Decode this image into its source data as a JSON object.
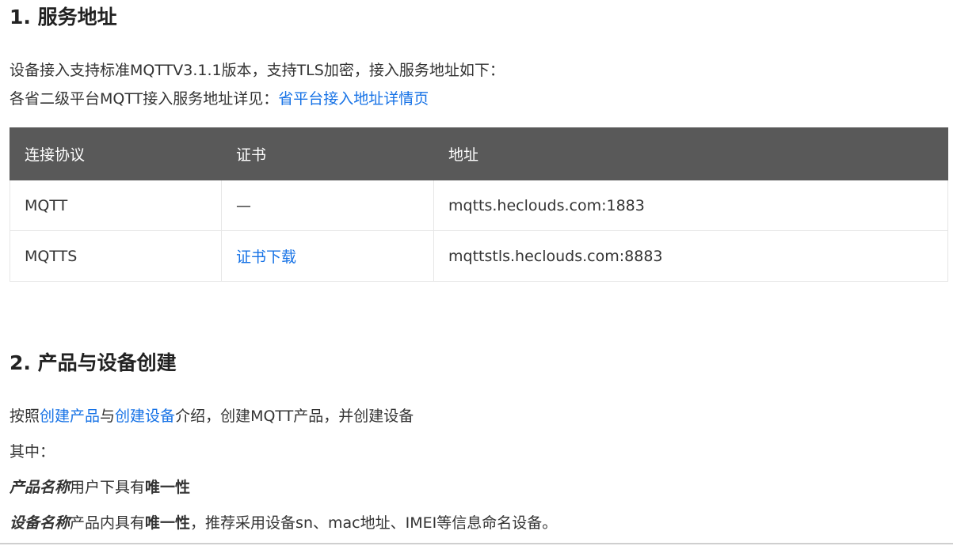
{
  "section1": {
    "heading": "1. 服务地址",
    "line1": "设备接入支持标准MQTTV3.1.1版本，支持TLS加密，接入服务地址如下：",
    "line2_prefix": "各省二级平台MQTT接入服务地址详见：",
    "line2_link": "省平台接入地址详情页",
    "table": {
      "headers": [
        "连接协议",
        "证书",
        "地址"
      ],
      "rows": [
        {
          "protocol": "MQTT",
          "cert": "—",
          "address": "mqtts.heclouds.com:1883"
        },
        {
          "protocol": "MQTTS",
          "cert": "证书下载",
          "address": "mqttstls.heclouds.com:8883"
        }
      ]
    }
  },
  "section2": {
    "heading": "2. 产品与设备创建",
    "line1_prefix": "按照",
    "line1_link1": "创建产品",
    "line1_mid": "与",
    "line1_link2": "创建设备",
    "line1_suffix": "介绍，创建MQTT产品，并创建设备",
    "line2": "其中：",
    "line3_em": "产品名称",
    "line3_mid": "用户下具有",
    "line3_bold": "唯一性",
    "line4_em": "设备名称",
    "line4_mid": "产品内具有",
    "line4_bold": "唯一性",
    "line4_suffix": "，推荐采用设备sn、mac地址、IMEI等信息命名设备。"
  },
  "colors": {
    "link": "#1672e6",
    "table_header_bg": "#595959",
    "text": "#333333"
  }
}
